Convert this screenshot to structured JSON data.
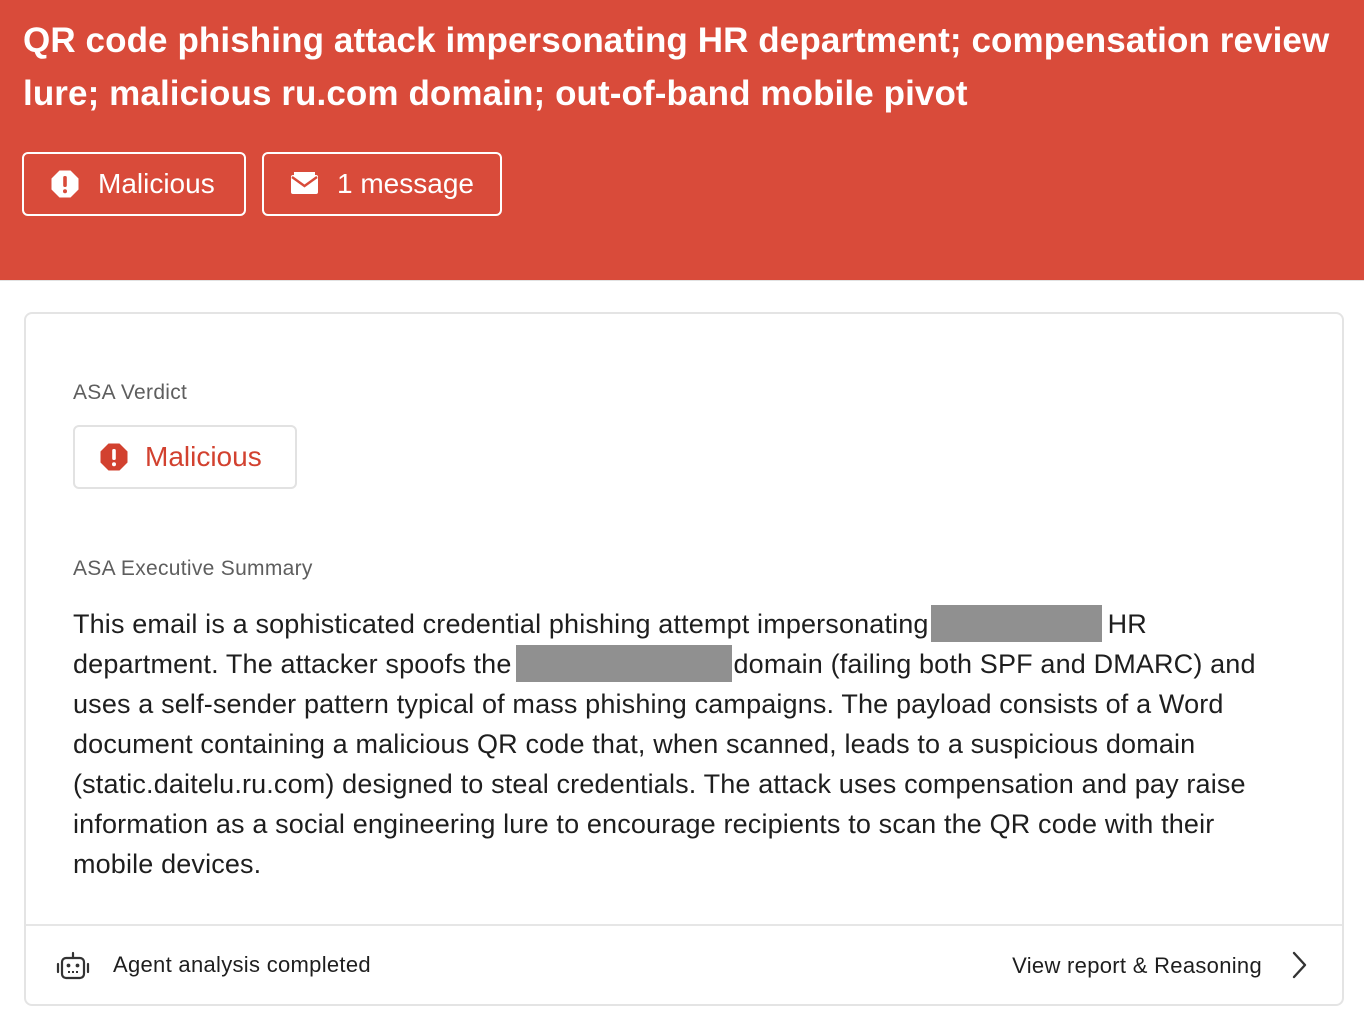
{
  "header": {
    "title": "QR code phishing attack impersonating HR department; compensation review lure; malicious ru.com domain; out-of-band mobile pivot",
    "verdict_label": "Malicious",
    "message_count_label": "1 message",
    "background_color": "#d94b3a"
  },
  "verdict": {
    "section_label": "ASA Verdict",
    "label": "Malicious",
    "icon": "alert-octagon-icon",
    "color": "#d2412f"
  },
  "summary": {
    "section_label": "ASA Executive Summary",
    "text_1": "This email is a sophisticated credential phishing attempt impersonating",
    "text_2": "HR department. The attacker spoofs the",
    "text_3": "domain (failing both SPF and DMARC) and uses a self-sender pattern typical of mass phishing campaigns. The payload consists of a Word document containing a malicious QR code that, when scanned, leads to a suspicious domain (static.daitelu.ru.com) designed to steal credentials. The attack uses compensation and pay raise information as a social engineering lure to encourage recipients to scan the QR code with their mobile devices."
  },
  "footer": {
    "status": "Agent analysis completed",
    "link_label": "View report & Reasoning",
    "status_icon": "robot-icon",
    "link_icon": "chevron-right-icon"
  }
}
